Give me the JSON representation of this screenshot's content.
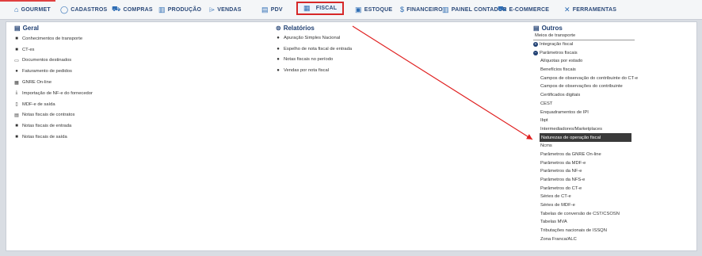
{
  "nav": [
    {
      "label": "GOURMET",
      "icon": "gourmet-icon"
    },
    {
      "label": "CADASTROS",
      "icon": "cadastros-icon"
    },
    {
      "label": "COMPRAS",
      "icon": "cart-icon"
    },
    {
      "label": "PRODUÇÃO",
      "icon": "factory-icon"
    },
    {
      "label": "VENDAS",
      "icon": "tag-icon"
    },
    {
      "label": "PDV",
      "icon": "pos-icon"
    },
    {
      "label": "FISCAL",
      "icon": "fiscal-icon"
    },
    {
      "label": "ESTOQUE",
      "icon": "box-icon"
    },
    {
      "label": "FINANCEIRO",
      "icon": "money-icon"
    },
    {
      "label": "PAINEL CONTADOR",
      "icon": "panel-icon"
    },
    {
      "label": "E-COMMERCE",
      "icon": "ecommerce-icon"
    },
    {
      "label": "FERRAMENTAS",
      "icon": "tools-icon"
    }
  ],
  "geral": {
    "title": "Geral",
    "items": [
      "Conhecimentos de transporte",
      "CT-es",
      "Documentos destinados",
      "Faturamento de pedidos",
      "GNRE On-line",
      "Importação de NF-e do fornecedor",
      "MDF-e de saída",
      "Notas fiscais de contratos",
      "Notas fiscais de entrada",
      "Notas fiscais de saída"
    ]
  },
  "relatorios": {
    "title": "Relatórios",
    "items": [
      "Apuração Simples Nacional",
      "Espelho de nota fiscal de entrada",
      "Notas fiscais no período",
      "Vendas por nota fiscal"
    ]
  },
  "outros": {
    "title": "Outros",
    "meios": "Meios de transporte",
    "integracao": "Integração fiscal",
    "parametros": "Parâmetros fiscais",
    "sub_items": [
      "Alíquotas por estado",
      "Benefícios fiscais",
      "Campos de observação do contribuinte do CT-e",
      "Campos de observações do contribuinte",
      "Certificados digitais",
      "CEST",
      "Enquadramentos de IPI",
      "Ibpt",
      "Intermediadores/Marketplaces",
      "Naturezas de operação fiscal",
      "Ncms",
      "Parâmetros da GNRE On-line",
      "Parâmetros da MDF-e",
      "Parâmetros da NF-e",
      "Parâmetros da NFS-e",
      "Parâmetros do CT-e",
      "Séries de CT-e",
      "Séries de MDF-e",
      "Tabelas de conversão de CST/CSOSN",
      "Tabelas MVA",
      "Tributações nacionais de ISSQN",
      "Zona Franca/ALC"
    ],
    "highlighted_index": 9
  },
  "colors": {
    "accent": "#1f3f72",
    "annotation": "#e02020",
    "highlight": "#3a3a3a"
  }
}
